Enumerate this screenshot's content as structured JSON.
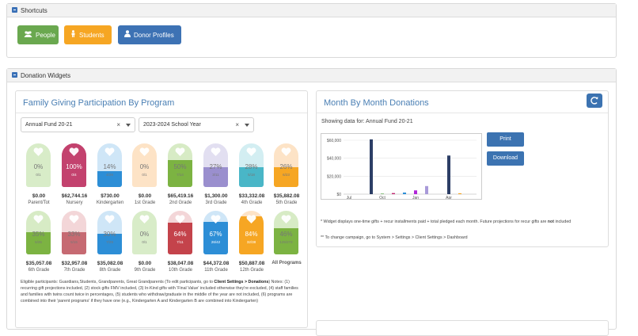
{
  "shortcuts": {
    "title": "Shortcuts",
    "buttons": [
      {
        "label": "People",
        "icon": "people-icon",
        "color": "#6aa84f"
      },
      {
        "label": "Students",
        "icon": "student-icon",
        "color": "#f6a623"
      },
      {
        "label": "Donor Profiles",
        "icon": "person-icon",
        "color": "#3d72b4"
      }
    ]
  },
  "donation_widgets": {
    "title": "Donation Widgets"
  },
  "family_giving": {
    "title": "Family Giving Participation By Program",
    "campaign_select": "Annual Fund 20-21",
    "year_select": "2023-2024 School Year",
    "tags": [
      {
        "pct": "0%",
        "frac": "0/1",
        "amount": "$0.00",
        "label": "Parent/Tot",
        "base": "#d8ecc8",
        "fill": "#a9d18e",
        "level": 0
      },
      {
        "pct": "100%",
        "frac": "0/4",
        "amount": "$62,744.16",
        "label": "Nursery",
        "base": "#c3426e",
        "fill": "#c3426e",
        "level": 1
      },
      {
        "pct": "14%",
        "frac": "4/29",
        "amount": "$730.00",
        "label": "Kindergarten",
        "base": "#cfe6f7",
        "fill": "#2d8ed6",
        "level": 0.14
      },
      {
        "pct": "0%",
        "frac": "0/1",
        "amount": "$0.00",
        "label": "1st Grade",
        "base": "#fde3c6",
        "fill": "#f6a623",
        "level": 0
      },
      {
        "pct": "50%",
        "frac": "7/14",
        "amount": "$65,419.16",
        "label": "2nd Grade",
        "base": "#d7ebc5",
        "fill": "#7cb342",
        "level": 0.5
      },
      {
        "pct": "27%",
        "frac": "3/11",
        "amount": "$1,300.00",
        "label": "3rd Grade",
        "base": "#e2dff1",
        "fill": "#9a8fce",
        "level": 0.27
      },
      {
        "pct": "28%",
        "frac": "5/18",
        "amount": "$33,332.08",
        "label": "4th Grade",
        "base": "#d3eef2",
        "fill": "#49b6c7",
        "level": 0.28
      },
      {
        "pct": "26%",
        "frac": "6/23",
        "amount": "$35,882.08",
        "label": "5th Grade",
        "base": "#fde3c6",
        "fill": "#f6a623",
        "level": 0.26
      },
      {
        "pct": "35%",
        "frac": "5/25",
        "amount": "$35,057.08",
        "label": "6th Grade",
        "base": "#d7ebc5",
        "fill": "#7cb342",
        "level": 0.35
      },
      {
        "pct": "33%",
        "frac": "5/15",
        "amount": "$32,957.08",
        "label": "7th Grade",
        "base": "#f3d6d8",
        "fill": "#c66a72",
        "level": 0.33
      },
      {
        "pct": "30%",
        "frac": "7/29",
        "amount": "$35,082.08",
        "label": "8th Grade",
        "base": "#cfe6f7",
        "fill": "#2d8ed6",
        "level": 0.3
      },
      {
        "pct": "0%",
        "frac": "0/1",
        "amount": "$0.00",
        "label": "9th Grade",
        "base": "#d8ecc8",
        "fill": "#a9d18e",
        "level": 0
      },
      {
        "pct": "64%",
        "frac": "7/11",
        "amount": "$38,047.08",
        "label": "10th Grade",
        "base": "#f3d6d8",
        "fill": "#c4434b",
        "level": 0.64
      },
      {
        "pct": "67%",
        "frac": "26/42",
        "amount": "$44,372.08",
        "label": "11th Grade",
        "base": "#cfe6f7",
        "fill": "#2d8ed6",
        "level": 0.67
      },
      {
        "pct": "84%",
        "frac": "32/38",
        "amount": "$50,887.08",
        "label": "12th Grade",
        "base": "#fde3c6",
        "fill": "#f6a623",
        "level": 0.84
      },
      {
        "pct": "46%",
        "frac": "125/272",
        "amount": "",
        "label": "All Programs",
        "base": "#d7ebc5",
        "fill": "#7cb342",
        "level": 0.46
      }
    ],
    "notes_prefix": "Eligible participants: Guardians,Students, Grandparents, Great Grandparents (To edit participants, go to ",
    "notes_link": "Client Settings > Donations",
    "notes_suffix": ") Notes: (1) recurring gift projections included, (2) stock gifts FMV included, (3) In-Kind gifts with 'Final Value' included otherwise they're excluded, (4) staff families and families with twins count twice in percentages, (5) students who withdraw/graduate in the middle of the year are not included, (6) programs are combined into their 'parent programs' if they have one (e.g., Kindergarten A and Kindergarten B are combined into Kindergarten)"
  },
  "month_donations": {
    "title": "Month By Month Donations",
    "showing": "Showing data for: Annual Fund 20-21",
    "print_label": "Print",
    "download_label": "Download",
    "footnote1_prefix": "* Widget displays one-time gifts + recur installments paid + total pledged each month. Future projections for recur gifts are ",
    "footnote1_bold": "not",
    "footnote1_suffix": " included",
    "footnote2": "** To change campaign, go to System > Settings > Client Settings > Dashboard"
  },
  "chart_data": {
    "type": "bar",
    "title": "",
    "xlabel": "",
    "ylabel": "",
    "ylim": [
      0,
      60000
    ],
    "yticks": [
      "$0",
      "$20,000",
      "$40,000",
      "$60,000"
    ],
    "xticks": [
      "Jul",
      "Oct",
      "Jan",
      "Apr"
    ],
    "categories": [
      "Jul",
      "Aug",
      "Sep",
      "Oct",
      "Nov",
      "Dec",
      "Jan",
      "Feb",
      "Mar",
      "Apr",
      "May",
      "Jun"
    ],
    "series": [
      {
        "name": "",
        "color": "#2c3e66",
        "values": [
          0,
          0,
          61000,
          0,
          0,
          0,
          0,
          0,
          0,
          43000,
          0,
          0
        ]
      },
      {
        "name": "",
        "color": "#5aa64a",
        "values": [
          0,
          0,
          0,
          600,
          0,
          0,
          0,
          0,
          0,
          0,
          0,
          0
        ]
      },
      {
        "name": "",
        "color": "#c0266f",
        "values": [
          0,
          0,
          0,
          0,
          1200,
          0,
          0,
          0,
          0,
          0,
          0,
          0
        ]
      },
      {
        "name": "",
        "color": "#2d8ed6",
        "values": [
          0,
          0,
          0,
          0,
          0,
          1800,
          0,
          0,
          0,
          0,
          0,
          0
        ]
      },
      {
        "name": "",
        "color": "#b026d8",
        "values": [
          0,
          0,
          0,
          0,
          0,
          0,
          4200,
          0,
          0,
          0,
          0,
          0
        ]
      },
      {
        "name": "",
        "color": "#a99ad9",
        "values": [
          0,
          0,
          0,
          0,
          0,
          0,
          0,
          9000,
          0,
          0,
          0,
          0
        ]
      },
      {
        "name": "",
        "color": "#f6a623",
        "values": [
          0,
          0,
          0,
          0,
          0,
          0,
          0,
          0,
          0,
          0,
          1000,
          0
        ]
      }
    ],
    "grid": true,
    "legend": "none"
  }
}
